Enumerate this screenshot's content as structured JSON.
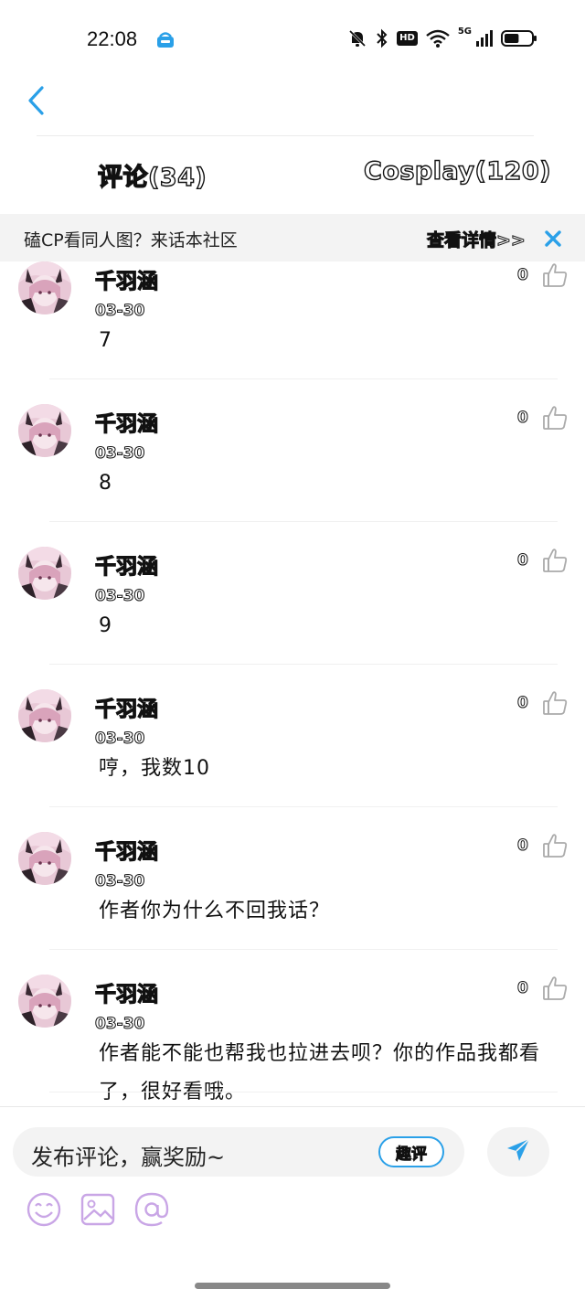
{
  "status_bar": {
    "time": "22:08",
    "network_label": "5G",
    "hd_label": "HD",
    "battery_level": 0.55,
    "icons": [
      "app-notification-icon",
      "mute-bell-icon",
      "bluetooth-icon",
      "hd-icon",
      "wifi-icon",
      "signal-icon",
      "battery-icon"
    ]
  },
  "header": {
    "back_icon": "chevron-left-icon",
    "tabs": [
      {
        "label": "评论(34)",
        "active": true
      },
      {
        "label": "Cosplay(120)",
        "active": false
      }
    ]
  },
  "banner": {
    "text": "磕CP看同人图？来话本社区",
    "link_label": "查看详情>>",
    "close_icon": "close-icon"
  },
  "comments": [
    {
      "username": "千羽涵",
      "date": "03-30",
      "text": "7",
      "likes": "0"
    },
    {
      "username": "千羽涵",
      "date": "03-30",
      "text": "8",
      "likes": "0"
    },
    {
      "username": "千羽涵",
      "date": "03-30",
      "text": "9",
      "likes": "0"
    },
    {
      "username": "千羽涵",
      "date": "03-30",
      "text": "哼，我数10",
      "likes": "0"
    },
    {
      "username": "千羽涵",
      "date": "03-30",
      "text": "作者你为什么不回我话？",
      "likes": "0"
    },
    {
      "username": "千羽涵",
      "date": "03-30",
      "text": "作者能不能也帮我也拉进去呗？你的作品我都看了，很好看哦。",
      "likes": "0"
    }
  ],
  "composer": {
    "placeholder": "发布评论，赢奖励~",
    "badge_label": "趣评",
    "send_icon": "send-icon",
    "toolbar": [
      "emoji-icon",
      "image-icon",
      "mention-icon"
    ]
  },
  "colors": {
    "accent_blue": "#2aa0e8",
    "toolbar_purple": "#c9a6e6",
    "banner_bg": "#f3f3f3"
  }
}
